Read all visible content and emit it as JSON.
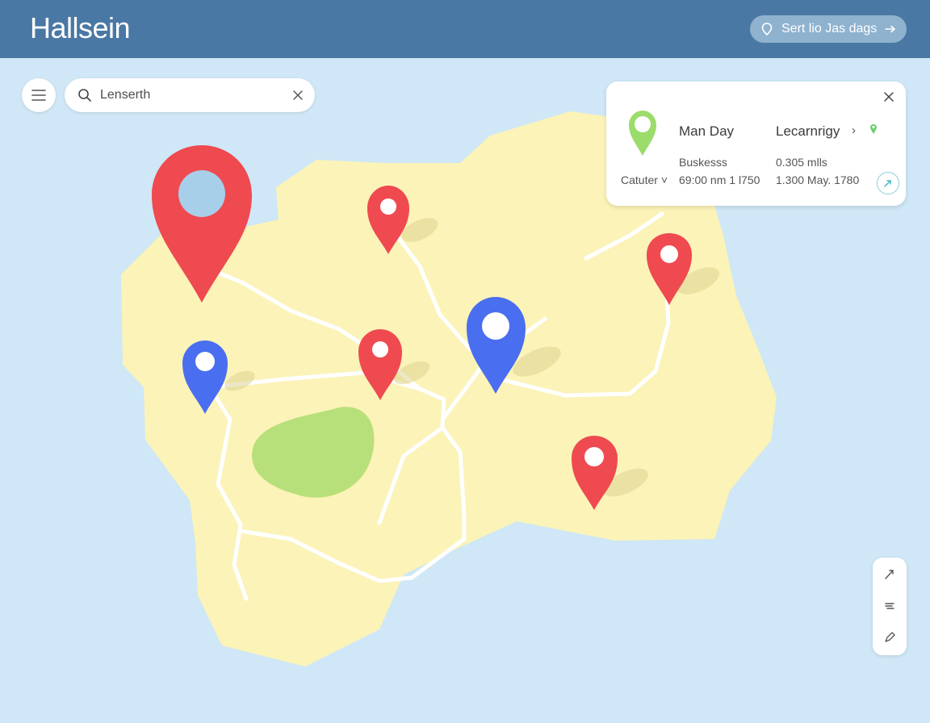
{
  "header": {
    "title": "Hallsein",
    "button_label": "Sert lio Jas dags"
  },
  "search": {
    "value": "Lenserth"
  },
  "info_card": {
    "title": "Man Day",
    "subtitle": "Lecarnrigy",
    "row1_label": "Buskesss",
    "row1_value": "0.305 mlls",
    "row2_label": "Catuter",
    "row2_time": "69:00 nm 1 l750",
    "row2_value": "1.300 May. 1780"
  },
  "colors": {
    "header": "#4a78a4",
    "water": "#cfe7f6",
    "land": "#fbf3b8",
    "park": "#b8e07a",
    "red_pin": "#ef4a50",
    "blue_pin": "#4a6ef0",
    "green_pin": "#9bdc6a"
  },
  "icons": {
    "menu": "hamburger-icon",
    "search": "search-icon",
    "clear": "close-icon",
    "header_button": "location-icon",
    "header_arrow": "arrow-right-icon",
    "card_close": "close-icon",
    "card_pin": "map-pin-icon",
    "card_action": "directions-icon",
    "controls": [
      "navigate-icon",
      "layers-icon",
      "draw-icon"
    ]
  },
  "map": {
    "markers": [
      {
        "type": "selected",
        "color": "red"
      },
      {
        "type": "pin",
        "color": "red"
      },
      {
        "type": "pin",
        "color": "red"
      },
      {
        "type": "pin",
        "color": "red"
      },
      {
        "type": "pin",
        "color": "red"
      },
      {
        "type": "pin",
        "color": "blue"
      },
      {
        "type": "pin",
        "color": "blue"
      }
    ]
  }
}
